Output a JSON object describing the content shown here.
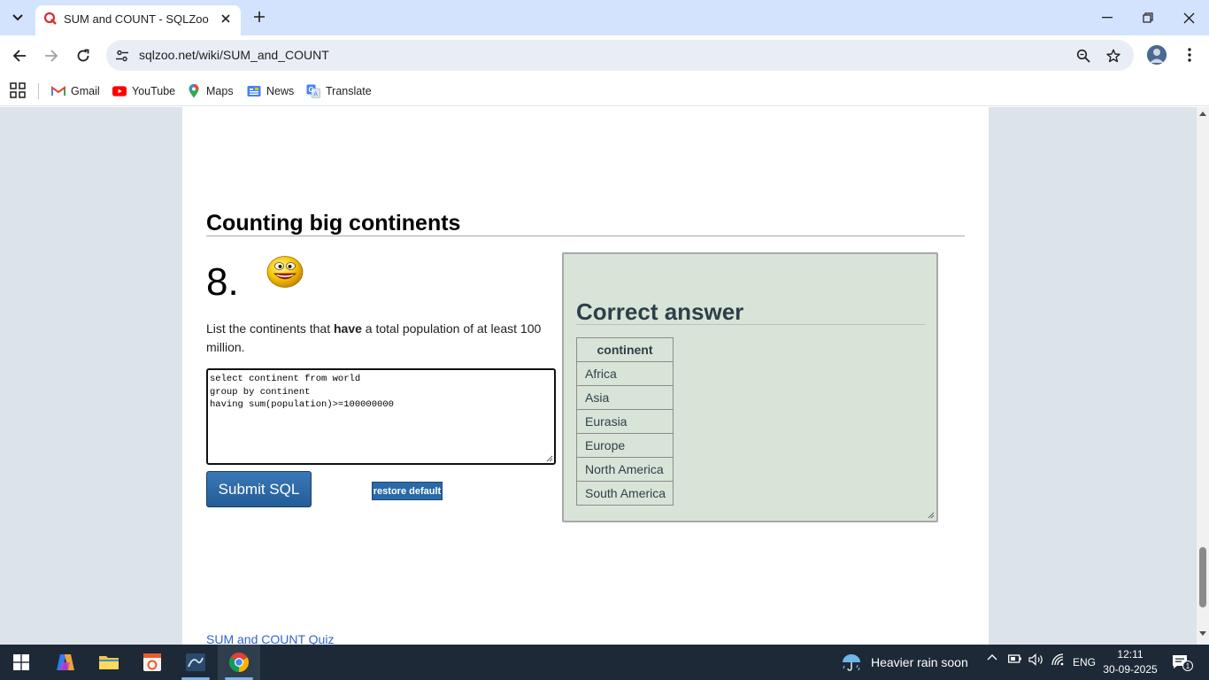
{
  "browser": {
    "tab_title": "SUM and COUNT - SQLZoo",
    "url": "sqlzoo.net/wiki/SUM_and_COUNT",
    "bookmarks": [
      "Gmail",
      "YouTube",
      "Maps",
      "News",
      "Translate"
    ]
  },
  "page": {
    "section_title": "Counting big continents",
    "question_number": "8.",
    "question_before": "List the continents that ",
    "question_bold": "have",
    "question_after": " a total population of at least 100 million.",
    "sql": "select continent from world\ngroup by continent\nhaving sum(population)>=100000000",
    "submit_label": "Submit SQL",
    "restore_label": "restore default",
    "answer_title": "Correct answer",
    "answer_header": "continent",
    "answer_rows": [
      "Africa",
      "Asia",
      "Eurasia",
      "Europe",
      "North America",
      "South America"
    ],
    "footer_link": "SUM and COUNT Quiz"
  },
  "taskbar": {
    "weather_text": "Heavier rain soon",
    "language": "ENG",
    "time": "12:11",
    "date": "30-09-2025",
    "notification_count": "1"
  },
  "colors": {
    "chrome_titlebar": "#d3e3fd",
    "answer_bg": "#d9e4d8",
    "submit_blue": "#2c67a3",
    "link_blue": "#3366cc",
    "taskbar": "#1d2936"
  }
}
